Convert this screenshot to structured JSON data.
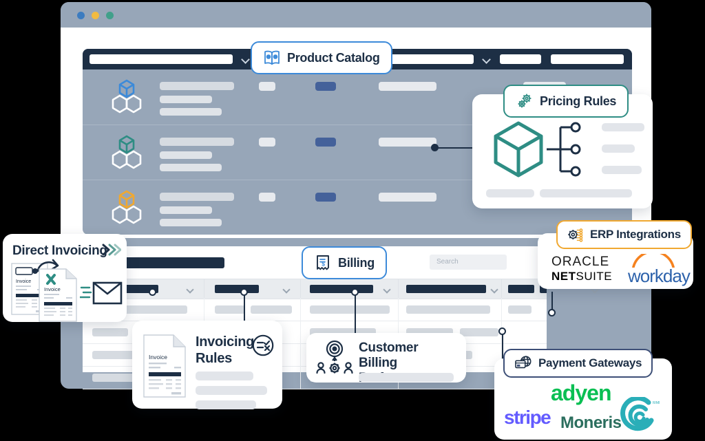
{
  "window": {
    "traffic_lights": [
      "blue",
      "yellow",
      "green"
    ]
  },
  "catalog": {
    "rows": [
      {
        "cube_color": "#3c8ad9"
      },
      {
        "cube_color": "#2e8d84"
      },
      {
        "cube_color": "#f0a830"
      }
    ]
  },
  "billing": {
    "search_placeholder": "Search",
    "row_count": 4
  },
  "badges": {
    "product_catalog": {
      "label": "Product Catalog",
      "icon": "book-icon",
      "color": "#3c8ad9"
    },
    "pricing_rules": {
      "label": "Pricing Rules",
      "icon": "gears-icon",
      "color": "#2e8d84"
    },
    "erp_integrations": {
      "label": "ERP Integrations",
      "icon": "gear-circuit-icon",
      "color": "#f0a830"
    },
    "billing": {
      "label": "Billing",
      "icon": "receipt-dollar-icon",
      "color": "#3c8ad9"
    },
    "payment_gateways": {
      "label": "Payment Gateways",
      "icon": "credit-card-globe-icon",
      "color": "#3d4f77"
    }
  },
  "cards": {
    "direct_invoicing": {
      "title": "Direct Invoicing",
      "icon": "chevrons-right-icon",
      "accent": "#2e8d84",
      "doc_label": "Invoice",
      "doc_label_2": "Invoice"
    },
    "invoicing_rules": {
      "title_line1": "Invoicing",
      "title_line2": "Rules",
      "icon": "rules-check-cross-icon",
      "doc_label": "Invoice"
    },
    "customer_billing_preferences": {
      "title_line1": "Customer",
      "title_line2": "Billing Preferences",
      "icon": "target-people-gear-icon"
    },
    "erp_logos": [
      "ORACLE",
      "NETSUITE",
      "workday"
    ],
    "payment_logos": [
      "stripe",
      "adyen",
      "Moneris"
    ]
  },
  "colors": {
    "navy": "#1d2f45",
    "slate": "#97a6b8",
    "blue": "#3c8ad9",
    "teal": "#2e8d84",
    "amber": "#f0a830",
    "stripe_purple": "#635bff",
    "adyen_green": "#0abf53",
    "moneris_teal": "#2b6e5e",
    "workday_blue": "#2d62ab"
  }
}
